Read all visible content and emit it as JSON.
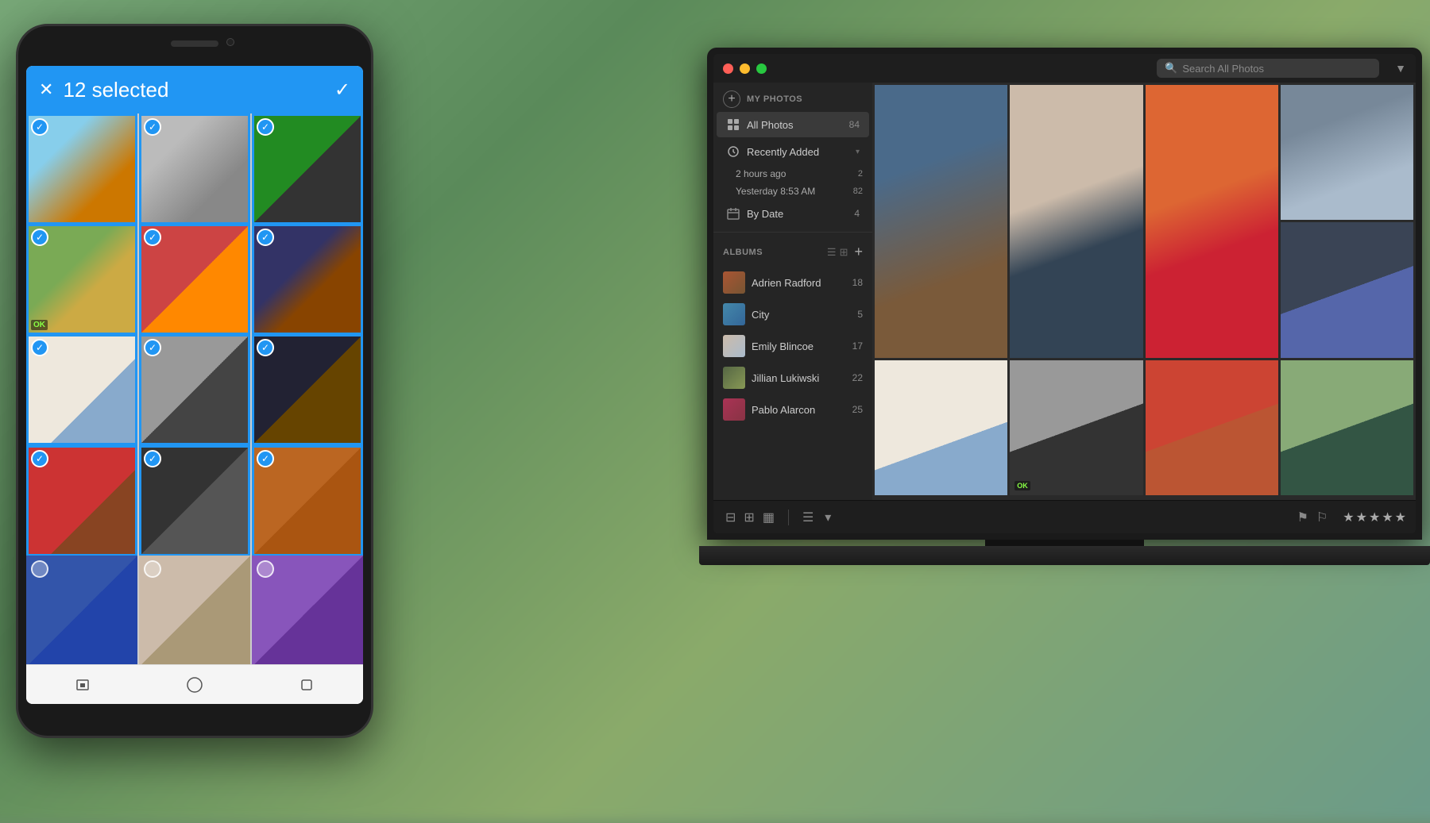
{
  "background": {
    "color": "#6a8a6a"
  },
  "phone": {
    "header": {
      "selected_count": "12 selected",
      "close_label": "✕",
      "check_label": "✓"
    },
    "grid": {
      "photos": [
        {
          "id": 1,
          "selected": true,
          "color_class": "p1"
        },
        {
          "id": 2,
          "selected": true,
          "color_class": "p2"
        },
        {
          "id": 3,
          "selected": true,
          "color_class": "p3"
        },
        {
          "id": 4,
          "selected": true,
          "color_class": "p4"
        },
        {
          "id": 5,
          "selected": true,
          "color_class": "p5"
        },
        {
          "id": 6,
          "selected": true,
          "color_class": "p6"
        },
        {
          "id": 7,
          "selected": true,
          "color_class": "p7"
        },
        {
          "id": 8,
          "selected": true,
          "color_class": "p8"
        },
        {
          "id": 9,
          "selected": true,
          "color_class": "p9"
        },
        {
          "id": 10,
          "selected": true,
          "color_class": "p10"
        },
        {
          "id": 11,
          "selected": true,
          "color_class": "p11"
        },
        {
          "id": 12,
          "selected": true,
          "color_class": "p12"
        },
        {
          "id": 13,
          "selected": false,
          "color_class": "p1"
        },
        {
          "id": 14,
          "selected": false,
          "color_class": "p3"
        },
        {
          "id": 15,
          "selected": false,
          "color_class": "p5"
        }
      ]
    },
    "nav": {
      "back_label": "◁",
      "home_label": "○",
      "recent_label": "□"
    }
  },
  "laptop": {
    "titlebar": {
      "search_placeholder": "Search All Photos",
      "filter_icon": "▼"
    },
    "sidebar": {
      "my_photos_label": "MY PHOTOS",
      "add_button": "+",
      "all_photos_label": "All Photos",
      "all_photos_count": "84",
      "recently_added_label": "Recently Added",
      "recently_added_arrow": "▾",
      "sub_items": [
        {
          "label": "2 hours ago",
          "count": "2"
        },
        {
          "label": "Yesterday 8:53 AM",
          "count": "82"
        }
      ],
      "by_date_label": "By Date",
      "by_date_count": "4",
      "albums_label": "ALBUMS",
      "albums_list_icon": "☰",
      "albums_grid_icon": "⊞",
      "albums_add": "+",
      "albums": [
        {
          "name": "Adrien Radford",
          "count": "18",
          "color_class": "at1"
        },
        {
          "name": "City",
          "count": "5",
          "color_class": "at2"
        },
        {
          "name": "Emily Blincoe",
          "count": "17",
          "color_class": "at3"
        },
        {
          "name": "Jillian Lukiwski",
          "count": "22",
          "color_class": "at4"
        },
        {
          "name": "Pablo Alarcon",
          "count": "25",
          "color_class": "at5"
        }
      ]
    },
    "main_grid": {
      "photos": [
        {
          "id": 1,
          "color_class": "gp1",
          "span_row": 2,
          "span_col": 1
        },
        {
          "id": 2,
          "color_class": "gp2",
          "span_row": 2,
          "span_col": 1
        },
        {
          "id": 3,
          "color_class": "gp3",
          "span_row": 2,
          "span_col": 1
        },
        {
          "id": 4,
          "color_class": "gp4",
          "span_row": 1,
          "span_col": 1
        },
        {
          "id": 5,
          "color_class": "gp5",
          "span_row": 1,
          "span_col": 1
        },
        {
          "id": 6,
          "color_class": "gp6",
          "span_row": 1,
          "span_col": 1
        },
        {
          "id": 7,
          "color_class": "gp7",
          "span_row": 1,
          "span_col": 1
        },
        {
          "id": 8,
          "color_class": "gp8",
          "span_row": 1,
          "span_col": 1
        },
        {
          "id": 9,
          "color_class": "gp9",
          "span_row": 1,
          "span_col": 1
        },
        {
          "id": 10,
          "color_class": "gp10",
          "span_row": 1,
          "span_col": 1
        },
        {
          "id": 11,
          "color_class": "gp11",
          "span_row": 1,
          "span_col": 1
        },
        {
          "id": 12,
          "color_class": "gp12",
          "span_row": 1,
          "span_col": 1
        }
      ]
    },
    "toolbar": {
      "view_icons": [
        "⊟",
        "⊞",
        "▦"
      ],
      "sort_icon": "☰",
      "sort_arrow": "▾",
      "flag_icons": [
        "⚑",
        "⚐"
      ],
      "stars": [
        "★",
        "★",
        "★",
        "★",
        "★"
      ]
    }
  }
}
